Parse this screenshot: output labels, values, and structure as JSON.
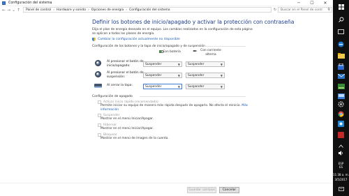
{
  "window": {
    "title": "Configuración del sistema",
    "controls": {
      "minimize": "─",
      "maximize": "☐",
      "close": "✕"
    }
  },
  "address": {
    "back": "←",
    "forward": "→",
    "recent": "⌄",
    "up": "↑",
    "crumbs": [
      "Panel de control",
      "Hardware y sonido",
      "Opciones de energía",
      "Configuración del sistema"
    ],
    "separator": "›",
    "refresh": "↻",
    "search_placeholder": "Buscar en el Panel de contr",
    "search_icon": "⚲"
  },
  "main": {
    "heading": "Definir los botones de inicio/apagado y activar la protección con contraseña",
    "intro": "Elija el plan de energía deseado en el equipo. Los cambios realizados en la configuración de esta página se aplican a todos los planes de energía.",
    "change_link": "Cambiar la configuración actualmente no disponible",
    "buttons_section": "Configuración de los botones y la tapa de inicio/apagado y de suspensión",
    "col_battery": "Con batería",
    "col_ac_line1": "Con corriente",
    "col_ac_line2": "alterna",
    "rows": [
      {
        "label_line1": "Al presionar el botón de",
        "label_line2": "inicio/apagado:",
        "battery": "Suspender",
        "ac": "Suspender"
      },
      {
        "label_line1": "Al presionar el botón de",
        "label_line2": "suspensión:",
        "battery": "Suspender",
        "ac": "Suspender"
      },
      {
        "label_line1": "Al cerrar la tapa:",
        "label_line2": "",
        "battery": "Suspender",
        "ac": "Suspender"
      }
    ],
    "shutdown_section": "Configuración de apagado",
    "options": [
      {
        "label": "Activar inicio rápido (recomendado)",
        "desc_line1": "Permite iniciar su equipo de manera más rápida después de apagarlo. No afecta el reinicio.",
        "link1": "Más",
        "link2": "información"
      },
      {
        "label": "Suspender",
        "desc_line1": "Mostrar en el menú Iniciar/Apagar."
      },
      {
        "label": "Hibernar",
        "desc_line1": "Mostrar en el menú Iniciar/Apagar."
      },
      {
        "label": "Bloquear",
        "desc_line1": "Mostrar en el menú de imagen de la cuenta."
      }
    ]
  },
  "footer": {
    "save": "Guardar cambios",
    "cancel": "Cancelar"
  },
  "taskbar": {
    "lang": "ESP",
    "lang2": "ES",
    "time": "11:38 a. m.",
    "date": "3/5/2017"
  }
}
